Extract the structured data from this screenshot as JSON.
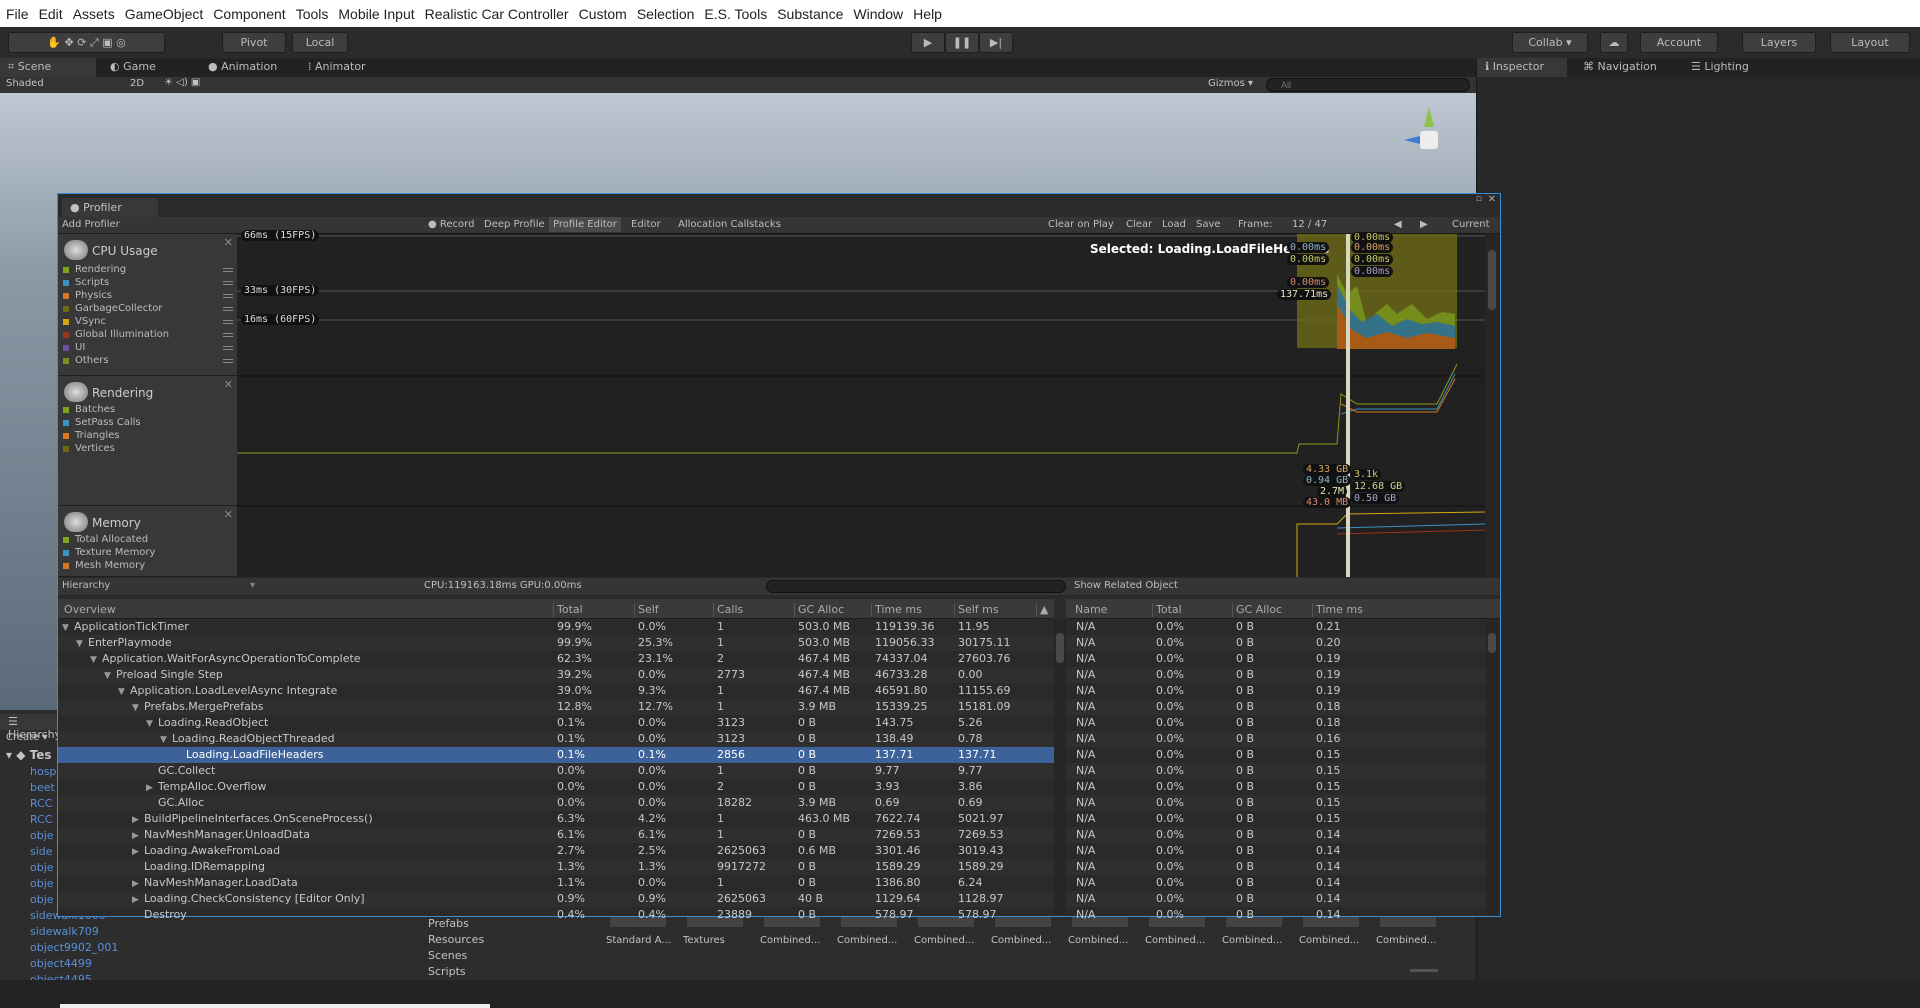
{
  "menu": [
    "File",
    "Edit",
    "Assets",
    "GameObject",
    "Component",
    "Tools",
    "Mobile Input",
    "Realistic Car Controller",
    "Custom",
    "Selection",
    "E.S. Tools",
    "Substance",
    "Window",
    "Help"
  ],
  "toolbar": {
    "pivot": "Pivot",
    "local": "Local",
    "collab": "Collab ▾",
    "account": "Account",
    "layers": "Layers",
    "layout": "Layout"
  },
  "tabs": {
    "scene": "Scene",
    "game": "Game",
    "animation": "Animation",
    "animator": "Animator",
    "inspector": "Inspector",
    "navigation": "Navigation",
    "lighting": "Lighting"
  },
  "scenebar": {
    "shading": "Shaded",
    "mode2d": "2D",
    "gizmos": "Gizmos ▾",
    "search_placeholder": "All"
  },
  "profiler": {
    "tab": "Profiler",
    "add": "Add Profiler",
    "buttons": {
      "record": "Record",
      "deep": "Deep Profile",
      "profile_editor": "Profile Editor",
      "editor": "Editor",
      "alloc": "Allocation Callstacks",
      "clear_on_play": "Clear on Play",
      "clear": "Clear",
      "load": "Load",
      "save": "Save",
      "frame_label": "Frame:",
      "frame": "12 / 47",
      "current": "Current"
    },
    "cpu": {
      "title": "CPU Usage",
      "items": [
        {
          "label": "Rendering",
          "color": "#7fa31b"
        },
        {
          "label": "Scripts",
          "color": "#3c93c0"
        },
        {
          "label": "Physics",
          "color": "#d9761d"
        },
        {
          "label": "GarbageCollector",
          "color": "#6e6a18"
        },
        {
          "label": "VSync",
          "color": "#d3a710"
        },
        {
          "label": "Global Illumination",
          "color": "#9e3317"
        },
        {
          "label": "UI",
          "color": "#6b4fa3"
        },
        {
          "label": "Others",
          "color": "#858a1e"
        }
      ]
    },
    "rendering": {
      "title": "Rendering",
      "items": [
        {
          "label": "Batches",
          "color": "#7fa31b"
        },
        {
          "label": "SetPass Calls",
          "color": "#3c93c0"
        },
        {
          "label": "Triangles",
          "color": "#d9761d"
        },
        {
          "label": "Vertices",
          "color": "#6e6a18"
        }
      ]
    },
    "memory": {
      "title": "Memory",
      "items": [
        {
          "label": "Total Allocated",
          "color": "#7fa31b"
        },
        {
          "label": "Texture Memory",
          "color": "#3c93c0"
        },
        {
          "label": "Mesh Memory",
          "color": "#d9761d"
        }
      ]
    },
    "chart": {
      "lines": [
        "66ms (15FPS)",
        "33ms (30FPS)",
        "16ms (60FPS)"
      ],
      "selected": "Selected: Loading.LoadFileHeaders",
      "cpu_labels": [
        "0.00ms",
        "0.00ms",
        "0.00ms",
        "0.00ms",
        "0.00ms",
        "0.00ms",
        "0.00ms",
        "137.71ms"
      ],
      "mem_labels_left": [
        "4.33 GB",
        "0.94 GB",
        "2.7M",
        "43.0 MB"
      ],
      "mem_labels_right": [
        "3.1k",
        "12.68 GB",
        "0.50 GB"
      ]
    },
    "hier_view": "Hierarchy",
    "cpu_gpu": "CPU:119163.18ms   GPU:0.00ms",
    "related": "Show Related Object",
    "columns": [
      "Overview",
      "Total",
      "Self",
      "Calls",
      "GC Alloc",
      "Time ms",
      "Self ms"
    ],
    "rows": [
      {
        "name": "ApplicationTickTimer",
        "lvl": 0,
        "arrow": "open",
        "v": [
          "99.9%",
          "0.0%",
          "1",
          "503.0 MB",
          "119139.36",
          "11.95"
        ]
      },
      {
        "name": "EnterPlaymode",
        "lvl": 1,
        "arrow": "open",
        "v": [
          "99.9%",
          "25.3%",
          "1",
          "503.0 MB",
          "119056.33",
          "30175.11"
        ]
      },
      {
        "name": "Application.WaitForAsyncOperationToComplete",
        "lvl": 2,
        "arrow": "open",
        "v": [
          "62.3%",
          "23.1%",
          "2",
          "467.4 MB",
          "74337.04",
          "27603.76"
        ]
      },
      {
        "name": "Preload Single Step",
        "lvl": 3,
        "arrow": "open",
        "v": [
          "39.2%",
          "0.0%",
          "2773",
          "467.4 MB",
          "46733.28",
          "0.00"
        ]
      },
      {
        "name": "Application.LoadLevelAsync Integrate",
        "lvl": 4,
        "arrow": "open",
        "v": [
          "39.0%",
          "9.3%",
          "1",
          "467.4 MB",
          "46591.80",
          "11155.69"
        ]
      },
      {
        "name": "Prefabs.MergePrefabs",
        "lvl": 5,
        "arrow": "open",
        "v": [
          "12.8%",
          "12.7%",
          "1",
          "3.9 MB",
          "15339.25",
          "15181.09"
        ]
      },
      {
        "name": "Loading.ReadObject",
        "lvl": 6,
        "arrow": "open",
        "v": [
          "0.1%",
          "0.0%",
          "3123",
          "0 B",
          "143.75",
          "5.26"
        ]
      },
      {
        "name": "Loading.ReadObjectThreaded",
        "lvl": 7,
        "arrow": "open",
        "v": [
          "0.1%",
          "0.0%",
          "3123",
          "0 B",
          "138.49",
          "0.78"
        ]
      },
      {
        "name": "Loading.LoadFileHeaders",
        "lvl": 8,
        "arrow": "none",
        "sel": true,
        "v": [
          "0.1%",
          "0.1%",
          "2856",
          "0 B",
          "137.71",
          "137.71"
        ]
      },
      {
        "name": "GC.Collect",
        "lvl": 6,
        "arrow": "none",
        "v": [
          "0.0%",
          "0.0%",
          "1",
          "0 B",
          "9.77",
          "9.77"
        ]
      },
      {
        "name": "TempAlloc.Overflow",
        "lvl": 6,
        "arrow": "closed",
        "v": [
          "0.0%",
          "0.0%",
          "2",
          "0 B",
          "3.93",
          "3.86"
        ]
      },
      {
        "name": "GC.Alloc",
        "lvl": 6,
        "arrow": "none",
        "v": [
          "0.0%",
          "0.0%",
          "18282",
          "3.9 MB",
          "0.69",
          "0.69"
        ]
      },
      {
        "name": "BuildPipelineInterfaces.OnSceneProcess()",
        "lvl": 5,
        "arrow": "closed",
        "v": [
          "6.3%",
          "4.2%",
          "1",
          "463.0 MB",
          "7622.74",
          "5021.97"
        ]
      },
      {
        "name": "NavMeshManager.UnloadData",
        "lvl": 5,
        "arrow": "closed",
        "v": [
          "6.1%",
          "6.1%",
          "1",
          "0 B",
          "7269.53",
          "7269.53"
        ]
      },
      {
        "name": "Loading.AwakeFromLoad",
        "lvl": 5,
        "arrow": "closed",
        "v": [
          "2.7%",
          "2.5%",
          "2625063",
          "0.6 MB",
          "3301.46",
          "3019.43"
        ]
      },
      {
        "name": "Loading.IDRemapping",
        "lvl": 5,
        "arrow": "none",
        "v": [
          "1.3%",
          "1.3%",
          "9917272",
          "0 B",
          "1589.29",
          "1589.29"
        ]
      },
      {
        "name": "NavMeshManager.LoadData",
        "lvl": 5,
        "arrow": "closed",
        "v": [
          "1.1%",
          "0.0%",
          "1",
          "0 B",
          "1386.80",
          "6.24"
        ]
      },
      {
        "name": "Loading.CheckConsistency [Editor Only]",
        "lvl": 5,
        "arrow": "closed",
        "v": [
          "0.9%",
          "0.9%",
          "2625063",
          "40 B",
          "1129.64",
          "1128.97"
        ]
      },
      {
        "name": "Destroy",
        "lvl": 5,
        "arrow": "none",
        "v": [
          "0.4%",
          "0.4%",
          "23889",
          "0 B",
          "578.97",
          "578.97"
        ]
      }
    ],
    "related_columns": [
      "Name",
      "Total",
      "GC Alloc",
      "Time ms"
    ],
    "related_rows": [
      [
        "N/A",
        "0.0%",
        "0 B",
        "0.21"
      ],
      [
        "N/A",
        "0.0%",
        "0 B",
        "0.20"
      ],
      [
        "N/A",
        "0.0%",
        "0 B",
        "0.19"
      ],
      [
        "N/A",
        "0.0%",
        "0 B",
        "0.19"
      ],
      [
        "N/A",
        "0.0%",
        "0 B",
        "0.19"
      ],
      [
        "N/A",
        "0.0%",
        "0 B",
        "0.18"
      ],
      [
        "N/A",
        "0.0%",
        "0 B",
        "0.18"
      ],
      [
        "N/A",
        "0.0%",
        "0 B",
        "0.16"
      ],
      [
        "N/A",
        "0.0%",
        "0 B",
        "0.15"
      ],
      [
        "N/A",
        "0.0%",
        "0 B",
        "0.15"
      ],
      [
        "N/A",
        "0.0%",
        "0 B",
        "0.15"
      ],
      [
        "N/A",
        "0.0%",
        "0 B",
        "0.15"
      ],
      [
        "N/A",
        "0.0%",
        "0 B",
        "0.15"
      ],
      [
        "N/A",
        "0.0%",
        "0 B",
        "0.14"
      ],
      [
        "N/A",
        "0.0%",
        "0 B",
        "0.14"
      ],
      [
        "N/A",
        "0.0%",
        "0 B",
        "0.14"
      ],
      [
        "N/A",
        "0.0%",
        "0 B",
        "0.14"
      ],
      [
        "N/A",
        "0.0%",
        "0 B",
        "0.14"
      ],
      [
        "N/A",
        "0.0%",
        "0 B",
        "0.14"
      ]
    ]
  },
  "hierarchy": {
    "title": "Hierarchy",
    "create": "Create ▾",
    "scene": "Tes",
    "items": [
      "hosp",
      "beet",
      "RCC",
      "RCC",
      "obje",
      "side",
      "obje",
      "obje",
      "obje",
      "sidewalk1000",
      "sidewalk709",
      "object9902_001",
      "object4499",
      "object4495"
    ]
  },
  "project": {
    "folders": [
      "Prefabs",
      "Resources",
      "Scenes",
      "Scripts"
    ],
    "assets": [
      "Standard A...",
      "Textures",
      "Combined...",
      "Combined...",
      "Combined...",
      "Combined...",
      "Combined...",
      "Combined...",
      "Combined...",
      "Combined...",
      "Combined..."
    ]
  }
}
